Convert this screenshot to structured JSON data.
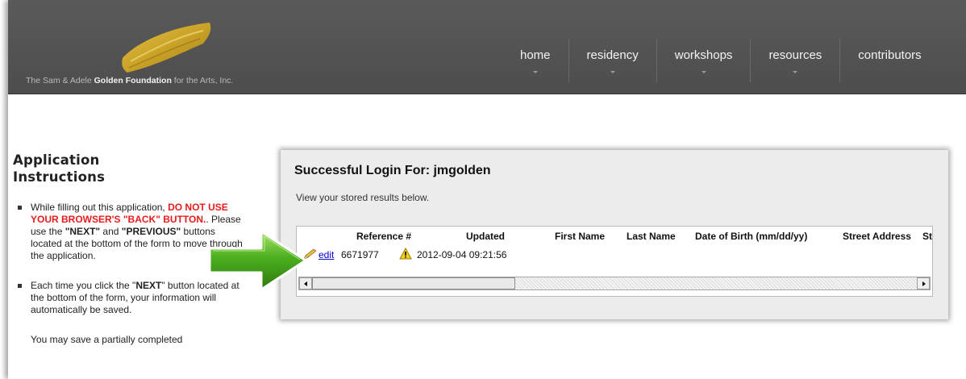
{
  "header": {
    "org_name_prefix": "The Sam & Adele ",
    "org_name_bold": "Golden Foundation",
    "org_name_suffix": " for the Arts, Inc.",
    "nav": [
      {
        "label": "home"
      },
      {
        "label": "residency"
      },
      {
        "label": "workshops"
      },
      {
        "label": "resources"
      },
      {
        "label": "contributors"
      }
    ]
  },
  "sidebar": {
    "heading": "Application Instructions",
    "item1": {
      "a": "While filling out this application, ",
      "b": "DO NOT USE YOUR BROWSER'S \"BACK\" BUTTON.",
      "c": ". Please use the ",
      "d": "\"NEXT\"",
      "e": " and ",
      "f": "\"PREVIOUS\"",
      "g": " buttons located at the bottom of the form to move through the application."
    },
    "item2": {
      "a": "Each time you click the \"",
      "b": "NEXT",
      "c": "\" button located at the bottom of the form, your information will automatically be saved."
    },
    "item3": "You may save a partially completed"
  },
  "panel": {
    "title": "Successful Login For: jmgolden",
    "subtitle": "View your stored results below.",
    "columns": [
      "Reference #",
      "Updated",
      "First Name",
      "Last Name",
      "Date of Birth (mm/dd/yy)",
      "Street Address",
      "St"
    ],
    "row": {
      "edit_label": "edit",
      "reference": "6671977",
      "updated": "2012-09-04 09:21:56"
    }
  },
  "colors": {
    "header_bg": "#4d4d4d",
    "logo_gold": "#c9a227",
    "warning_red": "#e81b1b",
    "link_blue": "#0000cc",
    "arrow_green": "#4caf1e"
  },
  "icons": [
    "pencil-icon",
    "warning-icon",
    "chevron-down-icon",
    "green-arrow-icon",
    "scroll-left-icon",
    "scroll-right-icon"
  ]
}
